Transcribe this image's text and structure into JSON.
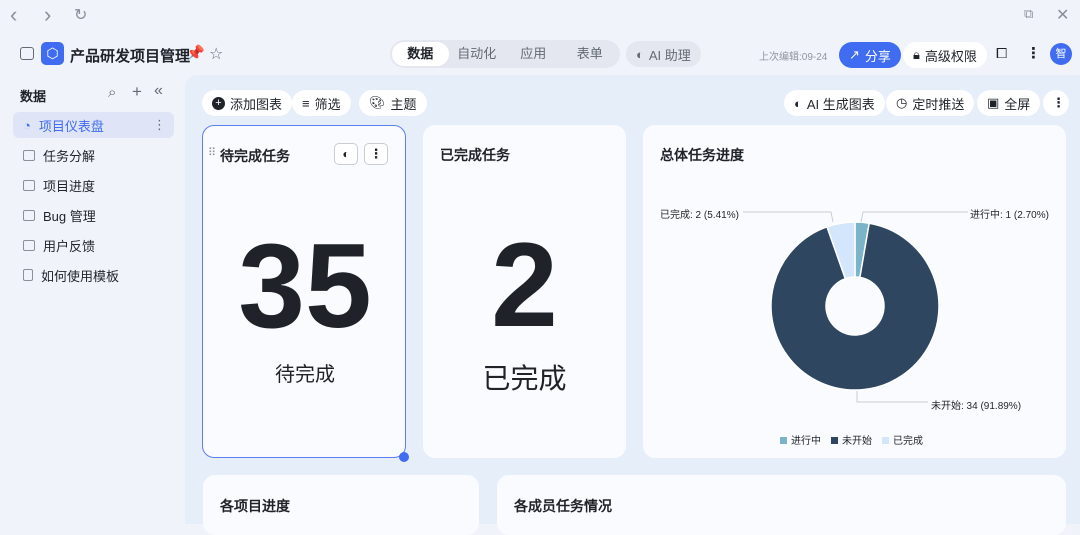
{
  "browser": {
    "back": "‹",
    "forward": "›",
    "reload": "↻"
  },
  "header": {
    "title": "产品研发项目管理",
    "tabs": [
      "数据",
      "自动化",
      "应用",
      "表单"
    ],
    "ai_assistant": "AI 助理",
    "last_edit": "上次编辑:09-24",
    "share": "分享",
    "permissions": "高级权限",
    "avatar": "智"
  },
  "sidebar": {
    "title": "数据",
    "items": [
      {
        "label": "项目仪表盘",
        "active": true
      },
      {
        "label": "任务分解"
      },
      {
        "label": "项目进度"
      },
      {
        "label": "Bug 管理"
      },
      {
        "label": "用户反馈"
      },
      {
        "label": "如何使用模板"
      }
    ]
  },
  "toolbar": {
    "add_chart": "添加图表",
    "filter": "筛选",
    "theme": "主题",
    "ai_chart": "AI 生成图表",
    "schedule": "定时推送",
    "fullscreen": "全屏"
  },
  "cards": {
    "pending": {
      "title": "待完成任务",
      "value": "35",
      "label": "待完成"
    },
    "done": {
      "title": "已完成任务",
      "value": "2",
      "label": "已完成"
    },
    "progress": {
      "title": "总体任务进度"
    },
    "projects": {
      "title": "各项目进度"
    },
    "members": {
      "title": "各成员任务情况"
    }
  },
  "chart_data": {
    "type": "pie",
    "title": "总体任务进度",
    "donut": true,
    "slices": [
      {
        "name": "进行中",
        "value": 1,
        "percent": 2.7,
        "color": "#7bb3c9",
        "label": "进行中: 1 (2.70%)"
      },
      {
        "name": "未开始",
        "value": 34,
        "percent": 91.89,
        "color": "#2f4661",
        "label": "未开始: 34 (91.89%)"
      },
      {
        "name": "已完成",
        "value": 2,
        "percent": 5.41,
        "color": "#d4e6fb",
        "label": "已完成: 2 (5.41%)"
      }
    ],
    "legend": [
      "进行中",
      "未开始",
      "已完成"
    ],
    "legend_position": "bottom"
  }
}
